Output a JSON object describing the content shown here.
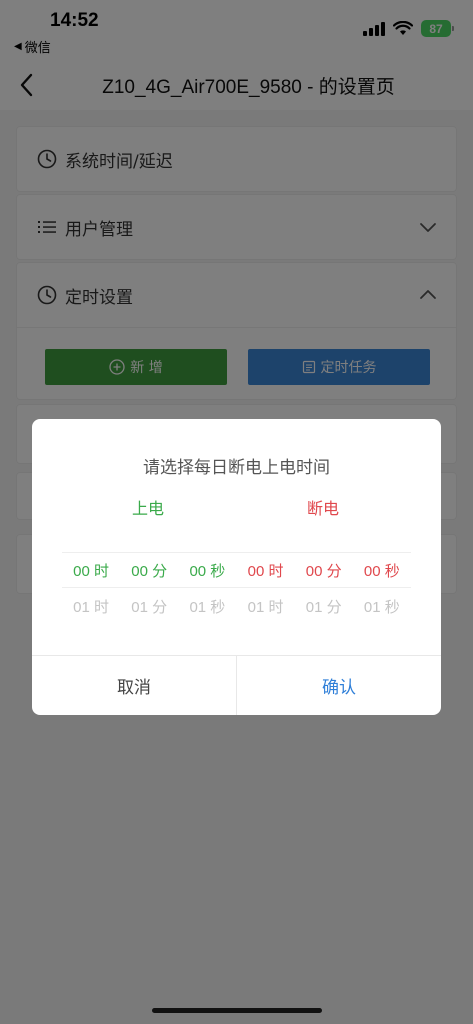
{
  "status": {
    "time": "14:52",
    "back_app": "微信",
    "battery": "87"
  },
  "nav": {
    "title": "Z10_4G_Air700E_9580 - 的设置页"
  },
  "sections": [
    {
      "label": "系统时间/延迟",
      "icon": "clock-icon"
    },
    {
      "label": "用户管理",
      "icon": "list-icon"
    },
    {
      "label": "定时设置",
      "icon": "clock-icon"
    }
  ],
  "timer_actions": {
    "add_label": "新 增",
    "task_label": "定时任务"
  },
  "dialog": {
    "title": "请选择每日断电上电时间",
    "power_on_label": "上电",
    "power_off_label": "断电",
    "selected_row": [
      "00 时",
      "00 分",
      "00 秒",
      "00 时",
      "00 分",
      "00 秒"
    ],
    "next_row": [
      "01 时",
      "01 分",
      "01 秒",
      "01 时",
      "01 分",
      "01 秒"
    ],
    "cancel_label": "取消",
    "confirm_label": "确认"
  },
  "colors": {
    "power_on": "#3aaa4a",
    "power_off": "#e0484d",
    "add_button": "#3f9d3f",
    "task_button": "#3b86d6",
    "confirm": "#2f7fd8",
    "battery": "#4cd964"
  }
}
